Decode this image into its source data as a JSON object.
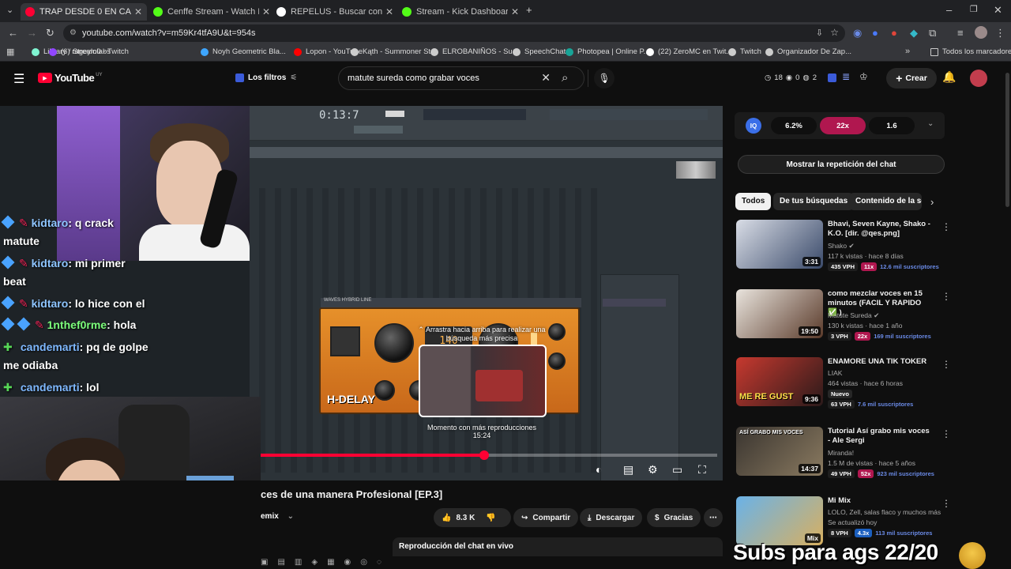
{
  "tabs": [
    {
      "title": "TRAP DESDE 0 EN CASA: Comp",
      "color": "#ff0033",
      "active": true
    },
    {
      "title": "Cenffe Stream - Watch Live on",
      "color": "#53fc18",
      "active": false
    },
    {
      "title": "REPELUS - Buscar con Google",
      "color": "#ffffff",
      "active": false
    },
    {
      "title": "Stream - Kick Dashboard",
      "color": "#53fc18",
      "active": false
    }
  ],
  "url": "youtube.com/watch?v=m59Kr4tfA9U&t=954s",
  "bookmarks": [
    {
      "label": "Library / Streamlabs",
      "color": "#80f5d2"
    },
    {
      "label": "(6) rageylo0 - Twitch",
      "color": "#9146ff"
    },
    {
      "label": "Noyh Geometric Bla...",
      "color": "#3ea6ff"
    },
    {
      "label": "Lopon - YouTube",
      "color": "#ff0000"
    },
    {
      "label": "Kąth - Summoner St...",
      "color": "#cccccc"
    },
    {
      "label": "ELROBANIÑOS - Su...",
      "color": "#cccccc"
    },
    {
      "label": "SpeechChat",
      "color": "#cccccc"
    },
    {
      "label": "Photopea | Online P...",
      "color": "#18a497"
    },
    {
      "label": "(22) ZeroMC en Twit...",
      "color": "#ffffff"
    },
    {
      "label": "Twitch",
      "color": "#cccccc"
    },
    {
      "label": "Organizador De Zap...",
      "color": "#cccccc"
    }
  ],
  "bookmarks_all": "Todos los marcadores",
  "yt": {
    "logo": "YouTube",
    "country": "UY",
    "filters": "Los filtros",
    "search_query": "matute sureda como grabar voces",
    "counters": [
      "18",
      "0",
      "2"
    ],
    "create": "Crear"
  },
  "stream_chat": [
    {
      "user": "kidtaro",
      "msg": ": q crack",
      "cont": "matute",
      "color": "blue"
    },
    {
      "user": "kidtaro",
      "msg": ": mi primer",
      "cont": "beat",
      "color": "blue"
    },
    {
      "user": "kidtaro",
      "msg": ": lo hice con el",
      "cont": "",
      "color": "blue"
    },
    {
      "user": "1nthef0rme",
      "msg": ": hola",
      "cont": "",
      "color": "green"
    },
    {
      "user": "candemarti",
      "msg": ": pq de golpe",
      "cont": "me odiaba",
      "color": "blue2"
    },
    {
      "user": "candemarti",
      "msg": ": lol",
      "cont": "",
      "color": "blue2"
    }
  ],
  "player": {
    "daw_time": "0:13:7",
    "plugin_name": "H-DELAY",
    "plugin_header": "WAVES HYBRID LINE",
    "swipe_hint": "Arrastra hacia arriba para realizar una búsqueda más precisa",
    "moment_label": "Momento con más reproducciones",
    "moment_time": "15:24",
    "progress": 0.5
  },
  "video": {
    "title": "ces de una manera Profesional [EP.3]",
    "channel_tail": "emix",
    "likes": "8.3 K",
    "share": "Compartir",
    "download": "Descargar",
    "thanks": "Gracias",
    "chat_replay_bar": "Reproducción del chat en vivo"
  },
  "ext_stats": {
    "a": "6.2%",
    "b": "22x",
    "c": "1.6"
  },
  "replay_button": "Mostrar la repetición del chat",
  "chips": [
    "Todos",
    "De tus búsquedas",
    "Contenido de la se"
  ],
  "recommendations": [
    {
      "title": "Bhavi, Seven Kayne, Shako - K.O. [dir. @qes.png]",
      "channel": "Shako",
      "meta": "117 k vistas · hace 8 días",
      "duration": "3:31",
      "vph": "435 VPH",
      "x": "11x",
      "x_color": "pink",
      "subs": "12.6 mil suscriptores",
      "thumb": [
        "#d9dde6",
        "#3a4a6a"
      ]
    },
    {
      "title": "como mezclar voces en 15 minutos (FACIL Y RAPIDO ✅ )",
      "channel": "Matute Sureda",
      "meta": "130 k vistas · hace 1 año",
      "duration": "19:50",
      "vph": "3 VPH",
      "x": "22x",
      "x_color": "pink",
      "subs": "169 mil suscriptores",
      "thumb": [
        "#e9e4dd",
        "#5a3a2a"
      ]
    },
    {
      "title": "ENAMORE UNA TIK TOKER",
      "channel": "LIAK",
      "meta": "464 vistas · hace 6 horas",
      "duration": "9:36",
      "vph": "63 VPH",
      "x": "",
      "x_color": "pink",
      "subs": "7.6 mil suscriptores",
      "badge": "Nuevo",
      "thumb": [
        "#c7392f",
        "#2a1a1a"
      ],
      "thumb_text": "ME RE GUST"
    },
    {
      "title": "Tutorial Así grabo mis voces - Ale Sergi",
      "channel": "Miranda!",
      "meta": "1.5 M de vistas · hace 5 años",
      "duration": "14:37",
      "vph": "49 VPH",
      "x": "52x",
      "x_color": "pink",
      "subs": "923 mil suscriptores",
      "thumb": [
        "#3a3530",
        "#8a7a60"
      ],
      "thumb_text": "ASÍ GRABO MIS VOCES"
    },
    {
      "title": "Mi Mix",
      "channel": "LOLO, Zell, salas flaco y muchos más",
      "meta": "Se actualizó hoy",
      "duration": "Mix",
      "vph": "8 VPH",
      "x": "4.3x",
      "x_color": "blue",
      "subs": "113 mil suscriptores",
      "thumb": [
        "#6ab2e8",
        "#d8b060"
      ]
    }
  ],
  "overlay_text": "Subs para ags 22/20"
}
